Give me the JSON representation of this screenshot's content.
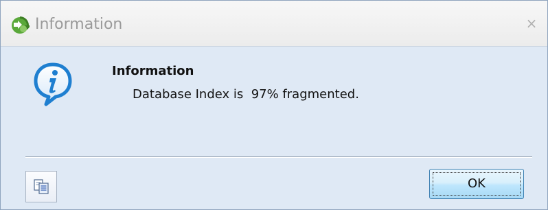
{
  "window": {
    "title": "Information",
    "app_icon": "green-arrow-icon",
    "close_glyph": "×"
  },
  "message": {
    "icon": "info-speech-bubble-icon",
    "title": "Information",
    "body": "Database Index is  97% fragmented."
  },
  "footer": {
    "copy_icon": "copy-icon",
    "ok_label": "OK"
  },
  "colors": {
    "body_bg": "#dfe9f5",
    "info_icon_blue": "#1f7fd0",
    "ok_border": "#3c7fb1"
  }
}
